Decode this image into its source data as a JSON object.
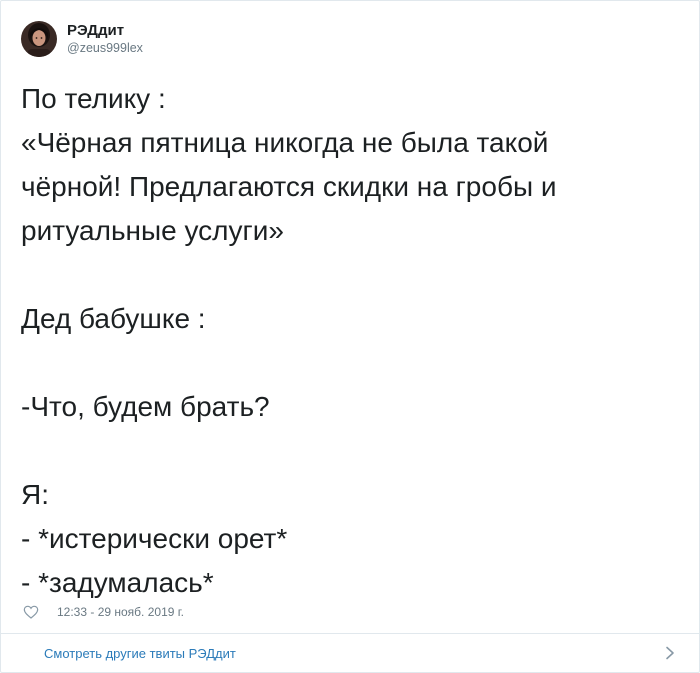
{
  "author": {
    "display_name": "РЭДдит",
    "handle": "@zeus999lex",
    "avatar_icon": "user-avatar-photo"
  },
  "tweet": {
    "lines": [
      "По телику :",
      "«Чёрная пятница никогда не была такой",
      "чёрной! Предлагаются скидки на гробы и",
      "ритуальные услуги»",
      "",
      "Дед бабушке :",
      "",
      "-Что, будем брать?",
      "",
      "Я:",
      "- *истерически орет*",
      "- *задумалась*"
    ]
  },
  "meta": {
    "like_icon": "heart-icon",
    "timestamp": "12:33 - 29 нояб. 2019 г."
  },
  "footer": {
    "link_label": "Смотреть другие твиты РЭДдит",
    "chevron_icon": "chevron-right-icon"
  },
  "colors": {
    "text": "#1c2022",
    "muted": "#697882",
    "link": "#2b7bb9",
    "border": "#e1e8ed"
  }
}
